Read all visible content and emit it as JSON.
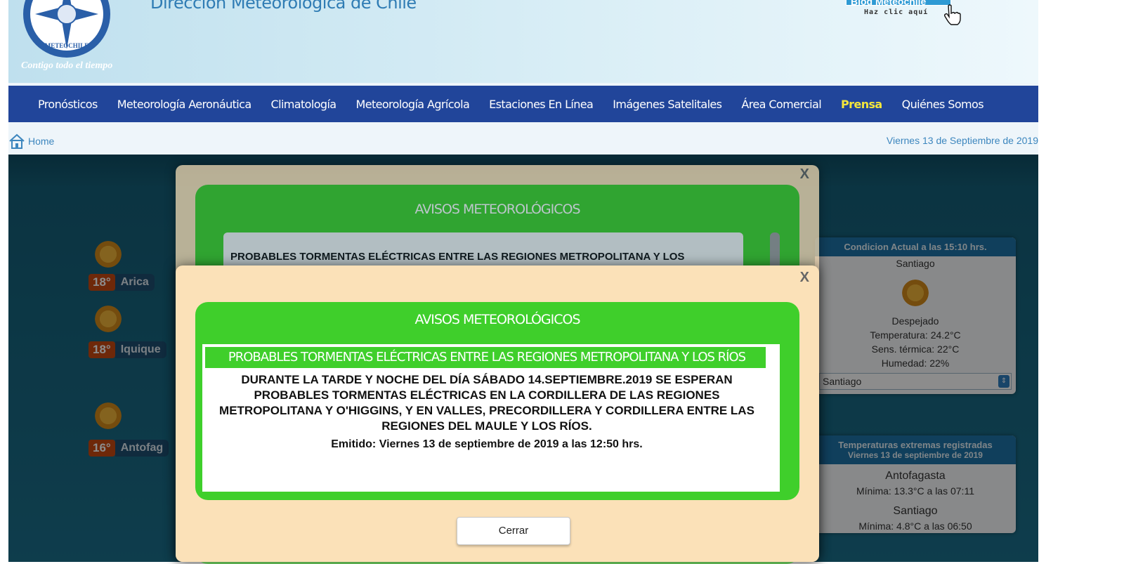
{
  "header": {
    "title": "Dirección Meteorológica de Chile",
    "logo_text": "METEOCHILE",
    "tagline": "Contigo todo el tiempo",
    "blog_label": "Blog Meteochile",
    "blog_cta": "Haz clic aquí"
  },
  "nav": {
    "items": [
      {
        "label": "Pronósticos"
      },
      {
        "label": "Meteorología Aeronáutica"
      },
      {
        "label": "Climatología"
      },
      {
        "label": "Meteorología Agrícola"
      },
      {
        "label": "Estaciones En Línea"
      },
      {
        "label": "Imágenes Satelitales"
      },
      {
        "label": "Área Comercial"
      },
      {
        "label": "Prensa",
        "active": true
      },
      {
        "label": "Quiénes Somos"
      }
    ]
  },
  "breadcrumb": {
    "home": "Home"
  },
  "date": "Viernes 13 de Septiembre de 2019",
  "map": {
    "cities": [
      {
        "temp": "18°",
        "name": "Arica"
      },
      {
        "temp": "18°",
        "name": "Iquique"
      },
      {
        "temp": "16°",
        "name": "Antofag"
      }
    ]
  },
  "current": {
    "title": "Condicion Actual a las 15:10 hrs.",
    "city": "Santiago",
    "condition": "Despejado",
    "temperature": "Temperatura: 24.2°C",
    "feels_like": "Sens. térmica: 22°C",
    "humidity": "Humedad: 22%",
    "selected_city": "Santiago"
  },
  "extremes": {
    "title": "Temperaturas extremas registradas",
    "subtitle": "Viernes 13 de septiembre de 2019",
    "entries": [
      {
        "city": "Antofagasta",
        "value": "Mínima: 13.3°C a las 07:11"
      },
      {
        "city": "Santiago",
        "value": "Mínima: 4.8°C a las 06:50"
      }
    ]
  },
  "modal": {
    "close_x": "X",
    "title": "AVISOS METEOROLÓGICOS",
    "back_preview": "PROBABLES TORMENTAS ELÉCTRICAS ENTRE LAS REGIONES METROPOLITANA Y LOS",
    "headline": "PROBABLES TORMENTAS ELÉCTRICAS ENTRE LAS REGIONES METROPOLITANA Y LOS RÍOS",
    "body": "DURANTE LA TARDE Y NOCHE DEL DÍA SÁBADO 14.SEPTIEMBRE.2019 SE ESPERAN PROBABLES TORMENTAS ELÉCTRICAS EN LA CORDILLERA DE LAS REGIONES METROPOLITANA Y O'HIGGINS, Y EN VALLES, PRECORDILLERA Y CORDILLERA ENTRE LAS REGIONES DEL MAULE Y LOS RÍOS.",
    "emitted": "Emitido: Viernes 13 de septiembre de 2019 a las 12:50 hrs.",
    "close_button": "Cerrar"
  },
  "colors": {
    "nav_bg": "#21459a",
    "nav_active": "#f4e63c",
    "alert_green": "#3fcf2b",
    "modal_bg": "#fbe1b8"
  }
}
